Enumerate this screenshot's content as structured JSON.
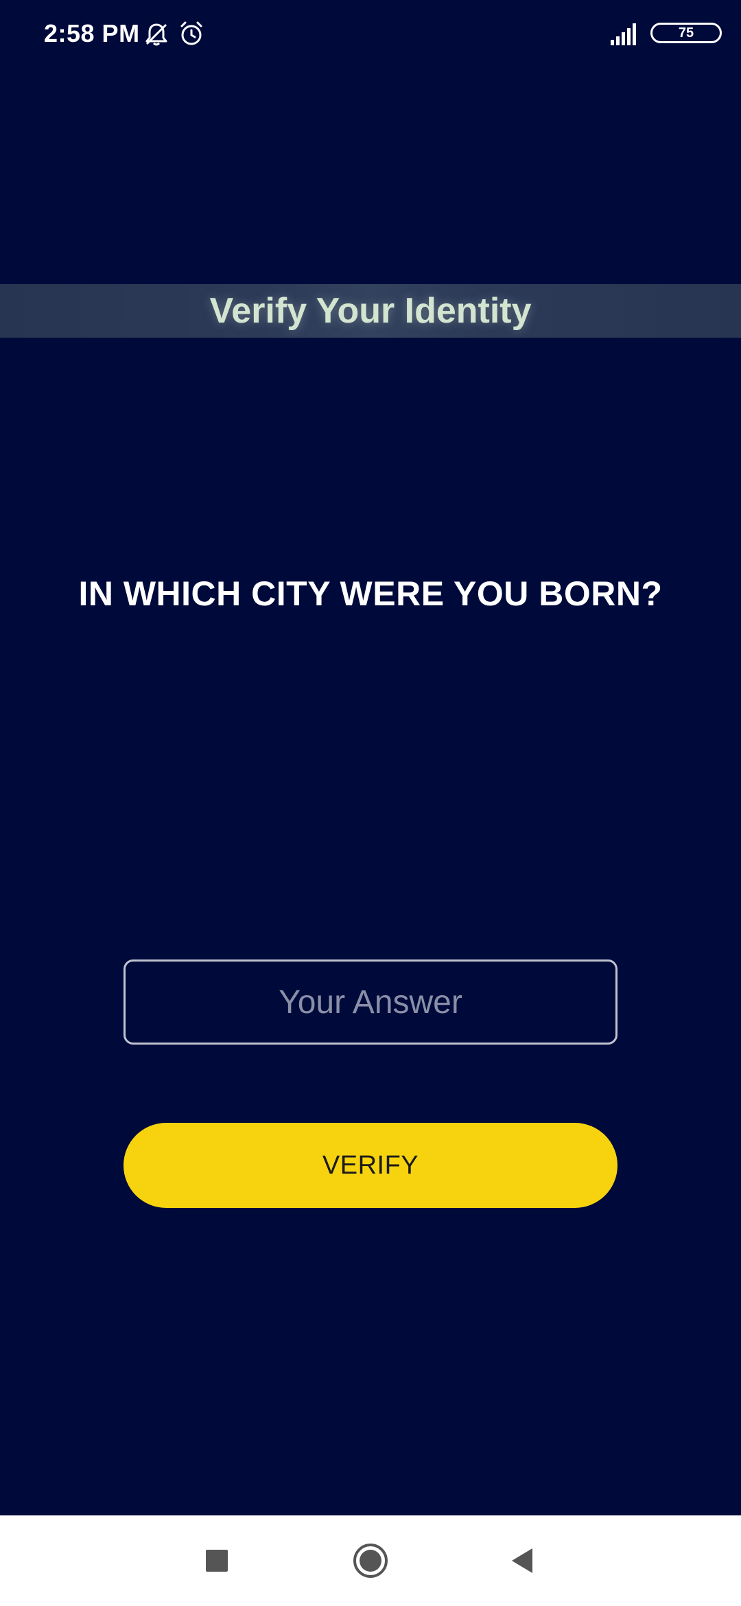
{
  "status_bar": {
    "time": "2:58 PM",
    "battery_level": "75",
    "icons": [
      "mute-icon",
      "alarm-icon",
      "signal-icon",
      "battery-icon"
    ]
  },
  "header": {
    "title": "Verify Your Identity"
  },
  "main": {
    "question": "IN WHICH CITY WERE YOU BORN?",
    "answer_input": {
      "placeholder": "Your Answer",
      "value": ""
    },
    "verify_label": "VERIFY"
  },
  "nav_bar": {
    "buttons": [
      "recents",
      "home",
      "back"
    ]
  },
  "colors": {
    "background": "#000a3a",
    "banner": "#2c3a58",
    "title_text": "#d3e4d0",
    "button": "#f6d30e",
    "button_text": "#1b1b1b",
    "nav_bar": "#ffffff",
    "nav_icon": "#555555"
  }
}
